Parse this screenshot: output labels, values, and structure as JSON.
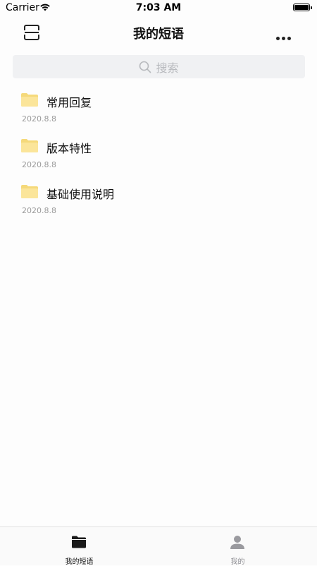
{
  "status": {
    "carrier": "Carrier",
    "time": "7:03 AM"
  },
  "nav": {
    "title": "我的短语"
  },
  "search": {
    "placeholder": "搜索"
  },
  "folders": [
    {
      "name": "常用回复",
      "date": "2020.8.8"
    },
    {
      "name": "版本特性",
      "date": "2020.8.8"
    },
    {
      "name": "基础使用说明",
      "date": "2020.8.8"
    }
  ],
  "tabs": [
    {
      "label": "我的短语",
      "icon": "folder-icon",
      "active": true
    },
    {
      "label": "我的",
      "icon": "person-icon",
      "active": false
    }
  ],
  "colors": {
    "folder": "#f5d97a",
    "active_tab": "#111111",
    "inactive_tab": "#8e8e93"
  }
}
